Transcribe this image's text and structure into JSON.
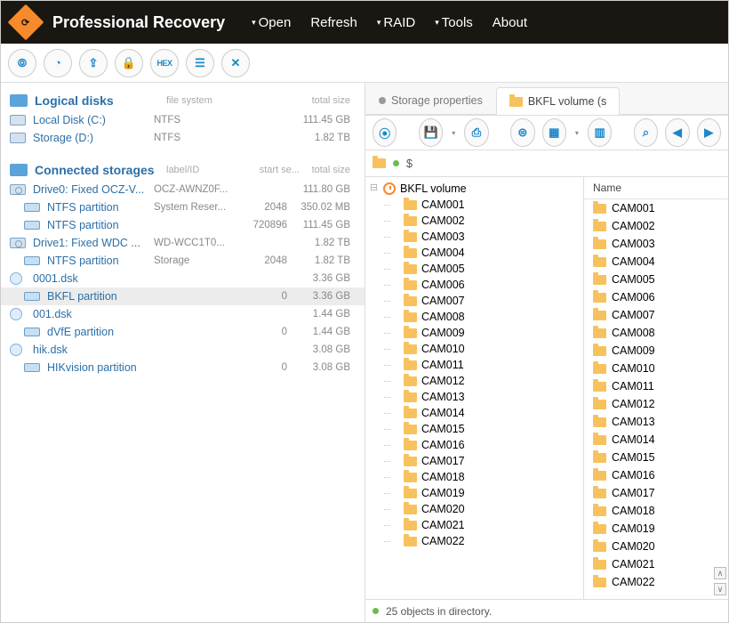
{
  "app_title": "Professional Recovery",
  "menu": [
    "Open",
    "Refresh",
    "RAID",
    "Tools",
    "About"
  ],
  "menu_has_arrow": [
    true,
    false,
    true,
    true,
    false
  ],
  "top_toolbar": [
    {
      "name": "scan-icon",
      "glyph": "⦾"
    },
    {
      "name": "chart-icon",
      "glyph": "◔"
    },
    {
      "name": "export-icon",
      "glyph": "⇪"
    },
    {
      "name": "lock-icon",
      "glyph": "🔒"
    },
    {
      "name": "hex-icon",
      "glyph": "HEX"
    },
    {
      "name": "list-icon",
      "glyph": "☰"
    },
    {
      "name": "close-icon",
      "glyph": "✕"
    }
  ],
  "sections": {
    "logical": {
      "title": "Logical disks",
      "cols": [
        "file system",
        "",
        "total size"
      ],
      "rows": [
        {
          "name": "Local Disk (C:)",
          "c1": "NTFS",
          "c3": "111.45 GB",
          "ico": "disk"
        },
        {
          "name": "Storage (D:)",
          "c1": "NTFS",
          "c3": "1.82 TB",
          "ico": "disk"
        }
      ]
    },
    "connected": {
      "title": "Connected storages",
      "cols": [
        "label/ID",
        "start se...",
        "total size"
      ],
      "rows": [
        {
          "name": "Drive0: Fixed OCZ-V...",
          "c1": "OCZ-AWNZ0F...",
          "c3": "111.80 GB",
          "ico": "hdd"
        },
        {
          "name": "NTFS partition",
          "c1": "System Reser...",
          "c2": "2048",
          "c3": "350.02 MB",
          "ico": "part",
          "child": true
        },
        {
          "name": "NTFS partition",
          "c1": "",
          "c2": "720896",
          "c3": "111.45 GB",
          "ico": "part",
          "child": true
        },
        {
          "name": "Drive1: Fixed WDC ...",
          "c1": "WD-WCC1T0...",
          "c3": "1.82 TB",
          "ico": "hdd"
        },
        {
          "name": "NTFS partition",
          "c1": "Storage",
          "c2": "2048",
          "c3": "1.82 TB",
          "ico": "part",
          "child": true
        },
        {
          "name": "0001.dsk",
          "c3": "3.36 GB",
          "ico": "file"
        },
        {
          "name": "BKFL partition",
          "c2": "0",
          "c3": "3.36 GB",
          "ico": "part",
          "child": true,
          "selected": true
        },
        {
          "name": "001.dsk",
          "c3": "1.44 GB",
          "ico": "file"
        },
        {
          "name": "dVfE partition",
          "c2": "0",
          "c3": "1.44 GB",
          "ico": "part",
          "child": true
        },
        {
          "name": "hik.dsk",
          "c3": "3.08 GB",
          "ico": "file"
        },
        {
          "name": "HIKvision partition",
          "c2": "0",
          "c3": "3.08 GB",
          "ico": "part",
          "child": true
        }
      ]
    }
  },
  "tabs": [
    {
      "label": "Storage properties",
      "active": false
    },
    {
      "label": "BKFL volume (s",
      "active": true
    }
  ],
  "inner_toolbar": [
    {
      "name": "search-icon",
      "glyph": "⦿",
      "drop": false
    },
    {
      "name": "save-icon",
      "glyph": "💾",
      "drop": true
    },
    {
      "name": "save-all-icon",
      "glyph": "⎙",
      "drop": false
    },
    {
      "name": "filter-icon",
      "glyph": "⊜",
      "drop": false
    },
    {
      "name": "view-icon",
      "glyph": "▦",
      "drop": true
    },
    {
      "name": "columns-icon",
      "glyph": "▥",
      "drop": false
    },
    {
      "name": "find-icon",
      "glyph": "⌕",
      "drop": false
    },
    {
      "name": "back-icon",
      "glyph": "◀",
      "drop": false
    },
    {
      "name": "forward-icon",
      "glyph": "▶",
      "drop": false
    }
  ],
  "breadcrumb": {
    "root_glyph": "$"
  },
  "tree": {
    "root": "BKFL volume",
    "items": [
      "CAM001",
      "CAM002",
      "CAM003",
      "CAM004",
      "CAM005",
      "CAM006",
      "CAM007",
      "CAM008",
      "CAM009",
      "CAM010",
      "CAM011",
      "CAM012",
      "CAM013",
      "CAM014",
      "CAM015",
      "CAM016",
      "CAM017",
      "CAM018",
      "CAM019",
      "CAM020",
      "CAM021",
      "CAM022"
    ]
  },
  "list": {
    "header": "Name",
    "items": [
      "CAM001",
      "CAM002",
      "CAM003",
      "CAM004",
      "CAM005",
      "CAM006",
      "CAM007",
      "CAM008",
      "CAM009",
      "CAM010",
      "CAM011",
      "CAM012",
      "CAM013",
      "CAM014",
      "CAM015",
      "CAM016",
      "CAM017",
      "CAM018",
      "CAM019",
      "CAM020",
      "CAM021",
      "CAM022"
    ]
  },
  "status": "25 objects in directory."
}
